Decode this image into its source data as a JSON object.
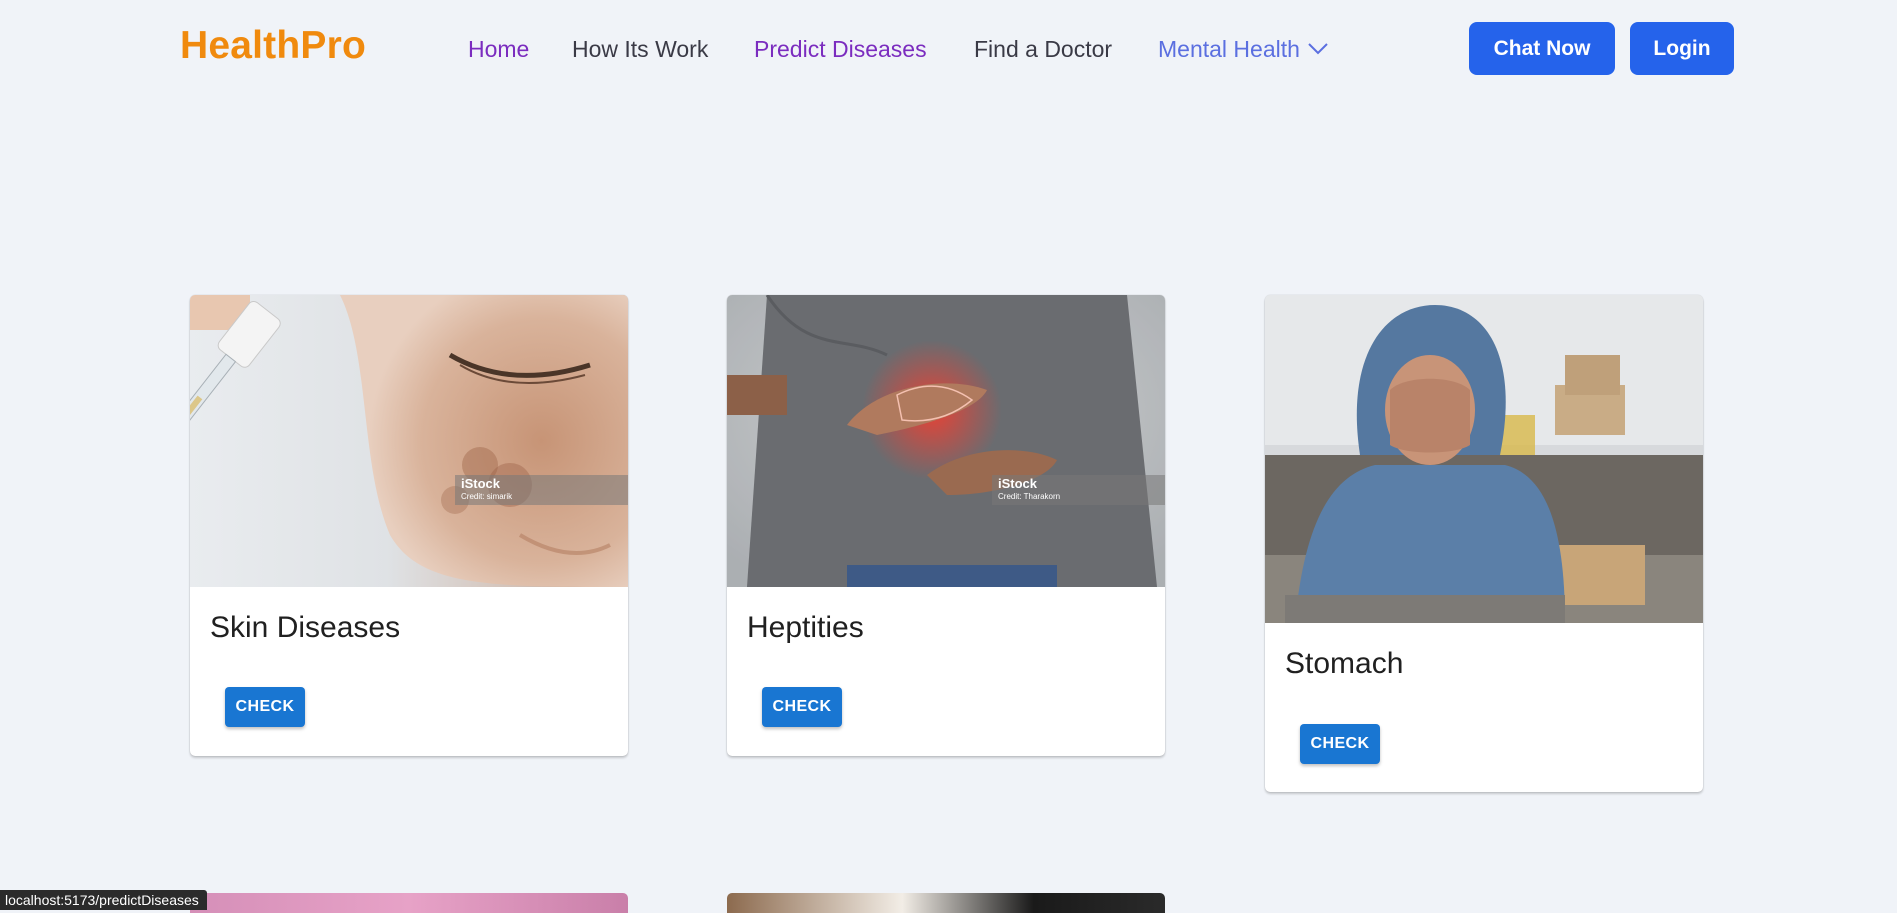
{
  "header": {
    "logo": "HealthPro",
    "nav": {
      "home": "Home",
      "how": "How Its Work",
      "predict": "Predict Diseases",
      "doctor": "Find a Doctor",
      "mental": "Mental Health"
    },
    "chat_label": "Chat Now",
    "login_label": "Login"
  },
  "cards": [
    {
      "title": "Skin Diseases",
      "button": "CHECK",
      "watermark": "iStock",
      "credit": "Credit: simarik"
    },
    {
      "title": "Heptities",
      "button": "CHECK",
      "watermark": "iStock",
      "credit": "Credit: Tharakorn"
    },
    {
      "title": "Stomach",
      "button": "CHECK"
    }
  ],
  "status_bar": {
    "url": "localhost:5173/predictDiseases"
  },
  "colors": {
    "logo": "#f08a0e",
    "nav_active": "#7b2cbf",
    "nav_mental": "#5b6fe0",
    "primary_button": "#2563eb",
    "check_button": "#1976d2",
    "page_bg": "#f0f3f8"
  }
}
